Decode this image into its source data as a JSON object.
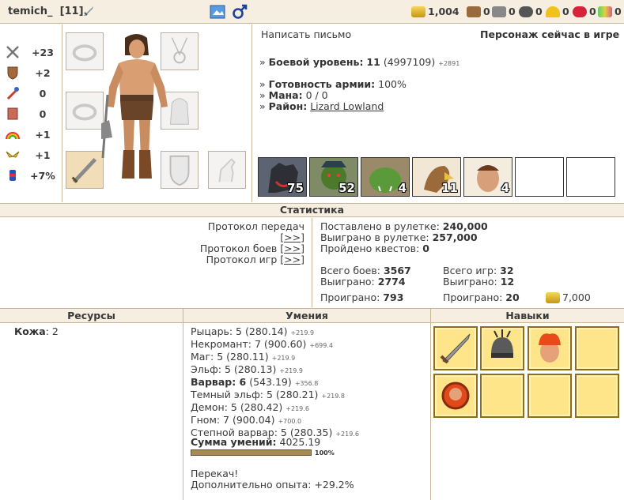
{
  "header": {
    "player_name": "temich_",
    "level": "[11]",
    "gold": "1,004",
    "resources": [
      "0",
      "0",
      "0",
      "0",
      "0",
      "0"
    ]
  },
  "stats": [
    {
      "icon": "sword-icon",
      "value": "+23"
    },
    {
      "icon": "shield-icon",
      "value": "+2"
    },
    {
      "icon": "wand-icon",
      "value": "0"
    },
    {
      "icon": "book-icon",
      "value": "0"
    },
    {
      "icon": "rainbow-icon",
      "value": "+1"
    },
    {
      "icon": "wings-icon",
      "value": "+1"
    },
    {
      "icon": "potion-icon",
      "value": "+7%"
    }
  ],
  "info": {
    "write_letter": "Написать письмо",
    "online_status": "Персонаж сейчас в игре",
    "combat_level_label": "Боевой уровень:",
    "combat_level": "11",
    "exp": "(4997109)",
    "exp_plus": "+2891",
    "army_ready_label": "Готовность армии:",
    "army_ready": "100%",
    "mana_label": "Мана:",
    "mana": "0 / 0",
    "district_label": "Район:",
    "district": "Lizard Lowland"
  },
  "army": [
    {
      "name": "wolf",
      "count": "75"
    },
    {
      "name": "orc",
      "count": "52"
    },
    {
      "name": "ogre",
      "count": "4"
    },
    {
      "name": "griffin",
      "count": "11"
    },
    {
      "name": "barbarian",
      "count": "4"
    }
  ],
  "statistics": {
    "title": "Статистика",
    "links": [
      {
        "label": "Протокол передач",
        "btn": "[>>]"
      },
      {
        "label": "Протокол боев",
        "btn": "[>>]"
      },
      {
        "label": "Протокол игр",
        "btn": "[>>]"
      }
    ],
    "roulette_bet_label": "Поставлено в рулетке:",
    "roulette_bet": "240,000",
    "roulette_won_label": "Выиграно в рулетке:",
    "roulette_won": "257,000",
    "quests_label": "Пройдено квестов:",
    "quests": "0",
    "battles_label": "Всего боев:",
    "battles": "3567",
    "won_label": "Выиграно:",
    "won": "2774",
    "lost_label": "Проиграно:",
    "lost": "793",
    "games_label": "Всего игр:",
    "games": "32",
    "games_won_label": "Выиграно:",
    "games_won": "12",
    "games_lost_label": "Проиграно:",
    "games_lost": "20",
    "games_gold": "7,000"
  },
  "resources": {
    "title": "Ресурсы",
    "items": [
      {
        "label": "Кожа",
        "value": ": 2"
      }
    ]
  },
  "skills": {
    "title": "Умения",
    "rows": [
      {
        "name": "Рыцарь: 5 (280.14)",
        "plus": "+219.9"
      },
      {
        "name": "Некромант: 7 (900.60)",
        "plus": "+699.4"
      },
      {
        "name": "Маг: 5 (280.11)",
        "plus": "+219.9"
      },
      {
        "name": "Эльф: 5 (280.13)",
        "plus": "+219.9"
      },
      {
        "name": "Варвар: 6",
        "extra": " (543.19)",
        "plus": "+356.8",
        "bold": true
      },
      {
        "name": "Темный эльф: 5 (280.21)",
        "plus": "+219.8"
      },
      {
        "name": "Демон: 5 (280.42)",
        "plus": "+219.6"
      },
      {
        "name": "Гном: 7 (900.04)",
        "plus": "+700.0"
      },
      {
        "name": "Степной варвар: 5 (280.35)",
        "plus": "+219.6"
      }
    ],
    "sum_label": "Сумма умений:",
    "sum": "4025.19",
    "progress_pct": "100%",
    "progress": 1.0,
    "overkill": "Перекач!",
    "extra_exp": "Дополнительно опыта: +29.2%"
  },
  "talents": {
    "title": "Навыки",
    "icons": [
      "sword-talent-icon",
      "helmet-talent-icon",
      "fire-head-talent-icon",
      "empty",
      "shield-face-talent-icon",
      "empty",
      "empty",
      "empty"
    ]
  }
}
